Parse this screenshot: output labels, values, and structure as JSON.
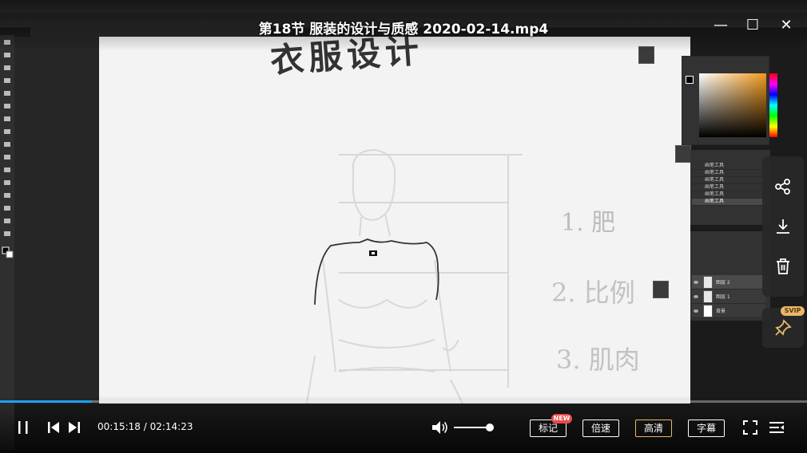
{
  "window": {
    "title": "第18节 服装的设计与质感 2020-02-14.mp4",
    "minimize_glyph": "—",
    "maximize_glyph": "☐",
    "close_glyph": "✕"
  },
  "photoshop": {
    "canvas_heading": "衣服设计",
    "canvas_notes": [
      "1. 肥",
      "2. 比例",
      "3. 肌肉"
    ],
    "history_items": [
      "画笔工具",
      "画笔工具",
      "画笔工具",
      "画笔工具",
      "画笔工具",
      "画笔工具"
    ],
    "layers": [
      "图层 2",
      "图层 1",
      "背景"
    ]
  },
  "side_actions": {
    "share_icon": "share-icon",
    "download_icon": "download-icon",
    "delete_icon": "trash-icon",
    "pin_icon": "pin-icon",
    "svip_badge": "SVIP"
  },
  "controls": {
    "current_time": "00:15:18",
    "duration": "02:14:23",
    "time_text": "00:15:18 / 02:14:23",
    "progress_fraction": 0.114,
    "volume_fraction": 0.9,
    "bookmark_label": "标记",
    "bookmark_badge": "NEW",
    "speed_label": "倍速",
    "quality_label": "高清",
    "subtitle_label": "字幕"
  },
  "colors": {
    "progress": "#1fa0f5",
    "quality_border": "#e8b86b",
    "new_badge": "#e94b4b",
    "svip_badge": "#e8b86b"
  }
}
